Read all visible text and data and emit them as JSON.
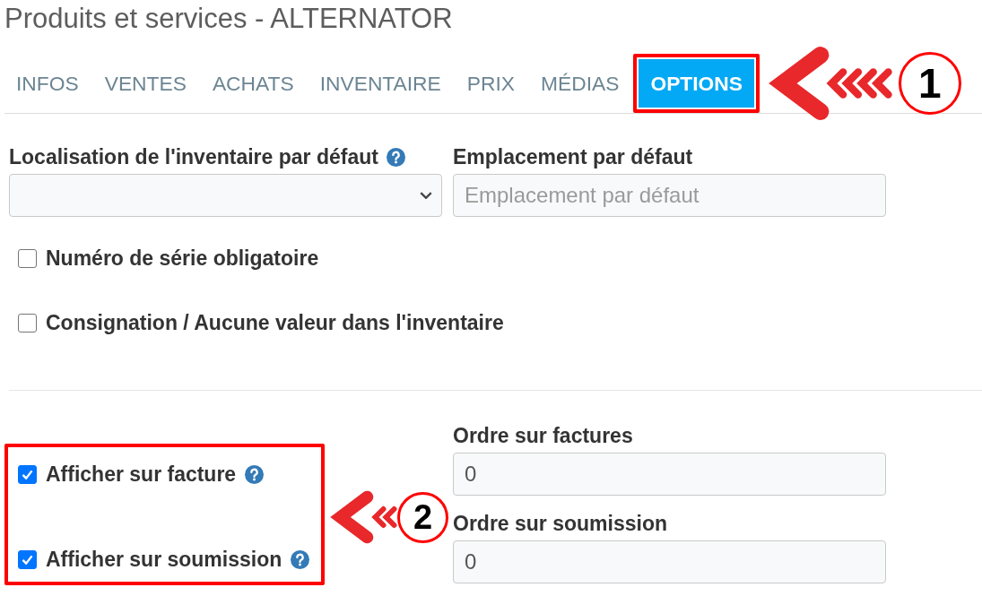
{
  "page_title": "Produits et services - ALTERNATOR",
  "tabs": [
    {
      "label": "INFOS",
      "selected": false,
      "highlighted": false
    },
    {
      "label": "VENTES",
      "selected": false,
      "highlighted": false
    },
    {
      "label": "ACHATS",
      "selected": false,
      "highlighted": false
    },
    {
      "label": "INVENTAIRE",
      "selected": false,
      "highlighted": false
    },
    {
      "label": "PRIX",
      "selected": false,
      "highlighted": false
    },
    {
      "label": "MÉDIAS",
      "selected": false,
      "highlighted": false
    },
    {
      "label": "OPTIONS",
      "selected": true,
      "highlighted": true
    }
  ],
  "tabs_callout": {
    "number": "1"
  },
  "location_fields": [
    {
      "kind": "select",
      "label": "Localisation de l'inventaire par défaut",
      "help": true
    },
    {
      "kind": "text",
      "label": "Emplacement par défaut",
      "placeholder": "Emplacement par défaut",
      "help": false
    }
  ],
  "options": [
    {
      "label": "Numéro de série obligatoire",
      "checked": false
    },
    {
      "label": "Consignation / Aucune valeur dans l'inventaire",
      "checked": false
    }
  ],
  "display_section": {
    "highlighted": true,
    "callout": {
      "number": "2"
    },
    "checkboxes": [
      {
        "label": "Afficher sur facture",
        "checked": true,
        "help": true
      },
      {
        "label": "Afficher sur soumission",
        "checked": true,
        "help": true
      }
    ],
    "order_fields": [
      {
        "label": "Ordre sur factures",
        "value": "0"
      },
      {
        "label": "Ordre sur soumission",
        "value": "0"
      }
    ]
  }
}
